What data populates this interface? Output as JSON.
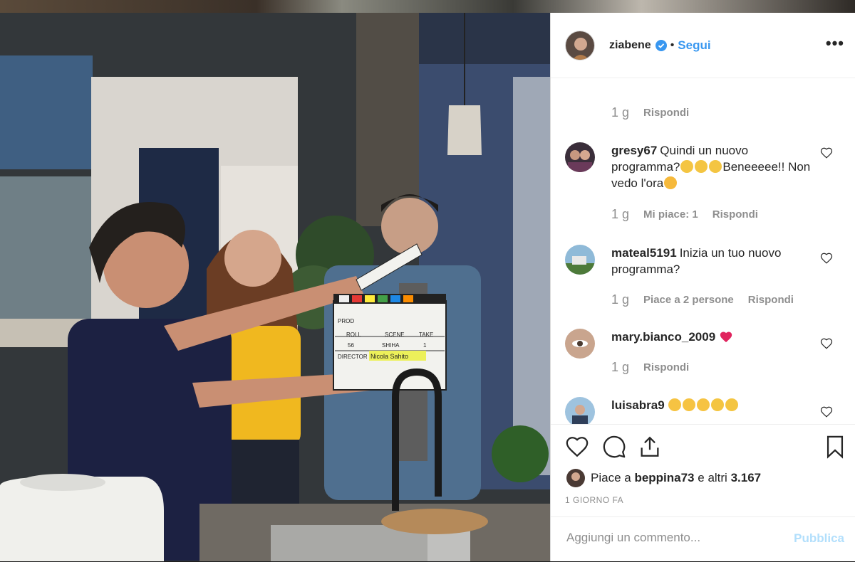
{
  "post": {
    "username": "ziabene",
    "dot": "•",
    "follow_label": "Segui",
    "more_label": "•••"
  },
  "comments": [
    {
      "time": "1 g",
      "reply": "Rispondi"
    },
    {
      "user": "gresy67",
      "text_a": "Quindi un nuovo programma?",
      "text_b": "Beneeeee!! Non vedo l'ora",
      "time": "1 g",
      "likes": "Mi piace: 1",
      "reply": "Rispondi",
      "emoji": [
        "clapping-hands",
        "clapping-hands",
        "clapping-hands",
        "hugging-face"
      ]
    },
    {
      "user": "mateal5191",
      "text": "Inizia un tuo nuovo programma?",
      "time": "1 g",
      "likes": "Piace a 2 persone",
      "reply": "Rispondi"
    },
    {
      "user": "mary.bianco_2009",
      "text": "",
      "time": "1 g",
      "reply": "Rispondi",
      "emoji": [
        "red-heart"
      ]
    },
    {
      "user": "luisabra9",
      "text": "",
      "emoji": [
        "winking-tongue",
        "winking-tongue",
        "winking-tongue",
        "clapping-hands",
        "clapping-hands"
      ]
    }
  ],
  "likes": {
    "prefix": "Piace a",
    "user": "beppina73",
    "middle": "e altri",
    "count": "3.167"
  },
  "time_ago": "1 GIORNO FA",
  "comment_box": {
    "placeholder": "Aggiungi un commento...",
    "publish_label": "Pubblica"
  },
  "clapper": {
    "director_label": "DIRECTOR",
    "director_name": "Nicola Sahito",
    "roll_label": "ROLL",
    "scene_label": "SCENE",
    "take_label": "TAKE",
    "prod_label": "PROD",
    "roll_value": "56",
    "scene_value": "SHIHA",
    "take_value": "1"
  },
  "colors": {
    "link": "#3897f0",
    "publish_disabled": "#b2dffc",
    "meta": "#8e8e8e",
    "text": "#262626",
    "verified": "#3897f0",
    "heart_red": "#ed4956"
  }
}
